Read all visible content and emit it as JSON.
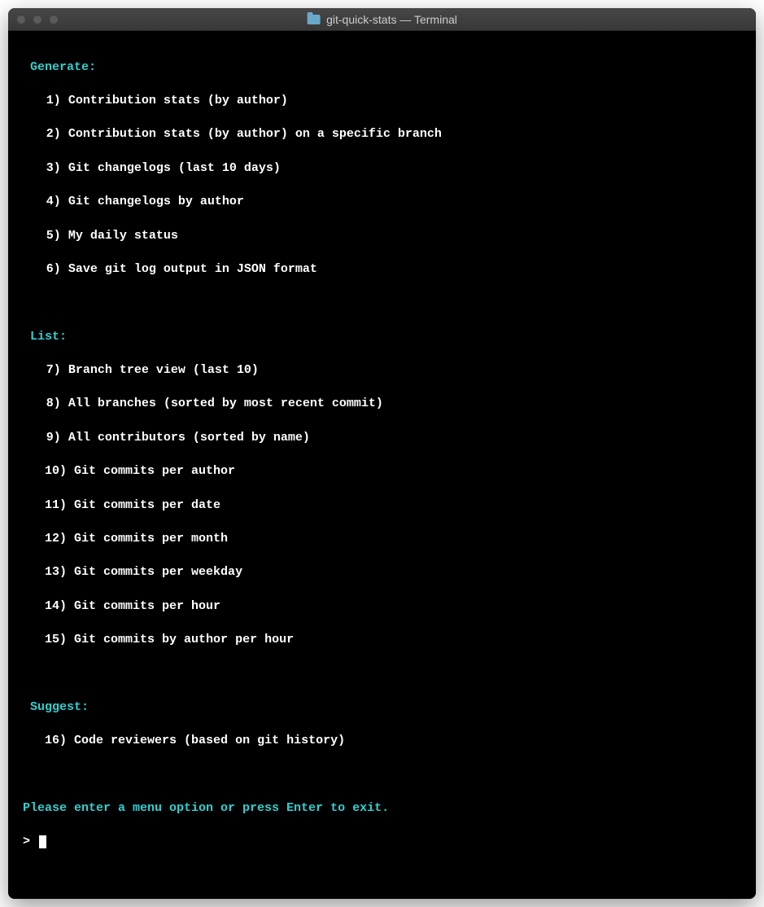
{
  "window": {
    "title": "git-quick-stats — Terminal"
  },
  "sections": {
    "generate": {
      "header": "Generate:",
      "items": [
        {
          "num": "1)",
          "label": "Contribution stats (by author)"
        },
        {
          "num": "2)",
          "label": "Contribution stats (by author) on a specific branch"
        },
        {
          "num": "3)",
          "label": "Git changelogs (last 10 days)"
        },
        {
          "num": "4)",
          "label": "Git changelogs by author"
        },
        {
          "num": "5)",
          "label": "My daily status"
        },
        {
          "num": "6)",
          "label": "Save git log output in JSON format"
        }
      ]
    },
    "list": {
      "header": "List:",
      "items": [
        {
          "num": "7)",
          "label": "Branch tree view (last 10)"
        },
        {
          "num": "8)",
          "label": "All branches (sorted by most recent commit)"
        },
        {
          "num": "9)",
          "label": "All contributors (sorted by name)"
        },
        {
          "num": "10)",
          "label": "Git commits per author"
        },
        {
          "num": "11)",
          "label": "Git commits per date"
        },
        {
          "num": "12)",
          "label": "Git commits per month"
        },
        {
          "num": "13)",
          "label": "Git commits per weekday"
        },
        {
          "num": "14)",
          "label": "Git commits per hour"
        },
        {
          "num": "15)",
          "label": "Git commits by author per hour"
        }
      ]
    },
    "suggest": {
      "header": "Suggest:",
      "items": [
        {
          "num": "16)",
          "label": "Code reviewers (based on git history)"
        }
      ]
    }
  },
  "prompt": {
    "text_a": "Please enter a menu option or ",
    "text_b": "press Enter to exit.",
    "caret": "> "
  }
}
